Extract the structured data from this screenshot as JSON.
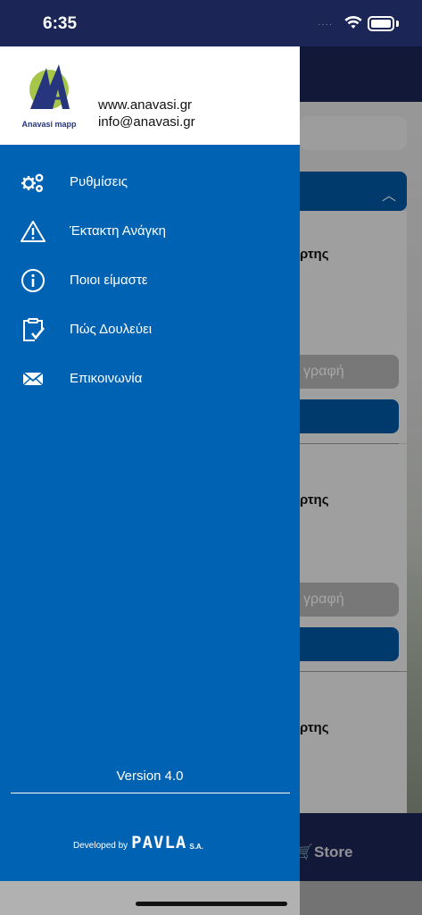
{
  "status_bar": {
    "time": "6:35",
    "signal": "····"
  },
  "drawer": {
    "logo_text": "Anavasi mapp",
    "website": "www.anavasi.gr",
    "email": "info@anavasi.gr",
    "menu": [
      {
        "label": "Ρυθμίσεις",
        "icon": "gears-icon"
      },
      {
        "label": "Έκτακτη Ανάγκη",
        "icon": "warning-icon"
      },
      {
        "label": "Ποιοι είμαστε",
        "icon": "info-icon"
      },
      {
        "label": "Πώς Δουλεύει",
        "icon": "clipboard-check-icon"
      },
      {
        "label": "Επικοινωνία",
        "icon": "envelope-icon"
      }
    ],
    "version": "Version 4.0",
    "developed_by": "Developed by",
    "developer_brand": "PAVLA",
    "developer_suffix": "S.A."
  },
  "background": {
    "card_title_fragment": "ρτης",
    "gray_button_fragment": "γραφή",
    "tab_store": "Store"
  },
  "colors": {
    "drawer": "#0062b3",
    "header": "#1c2656",
    "accent_blue": "#0058a7"
  }
}
